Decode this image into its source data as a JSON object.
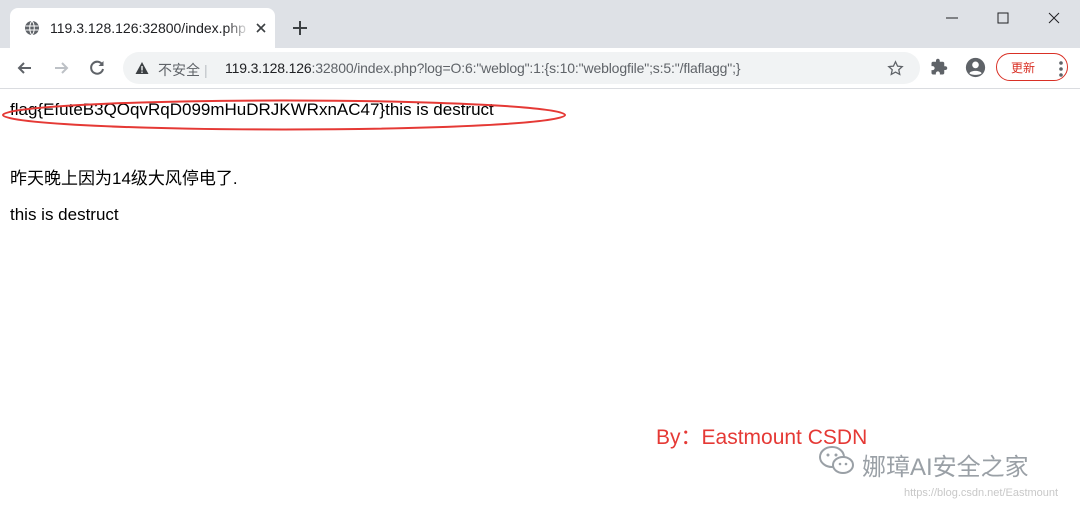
{
  "tab": {
    "title": "119.3.128.126:32800/index.php"
  },
  "omnibox": {
    "security_text": "不安全",
    "security_sep": "|",
    "url_host": "119.3.128.126",
    "url_rest": ":32800/index.php?log=O:6:\"weblog\":1:{s:10:\"weblogfile\";s:5:\"/flaflagg\";}"
  },
  "update_button": {
    "label": "更新"
  },
  "page": {
    "flag_line": "flag{EfuteB3QOqvRqD099mHuDRJKWRxnAC47}this is destruct",
    "note_line": "昨天晚上因为14级大风停电了.",
    "destruct_line": "this is destruct",
    "credit": "By：Eastmount CSDN"
  },
  "watermark": {
    "text": "娜璋AI安全之家",
    "url": "https://blog.csdn.net/Eastmount"
  },
  "colors": {
    "annotation_red": "#e53935",
    "tabstrip": "#dee1e6"
  },
  "icons": [
    "globe-icon",
    "close-icon",
    "plus-icon",
    "minimize-icon",
    "maximize-icon",
    "close-window-icon",
    "back-icon",
    "forward-icon",
    "reload-icon",
    "warning-icon",
    "star-icon",
    "extension-icon",
    "profile-icon",
    "menu-icon",
    "wechat-icon"
  ]
}
